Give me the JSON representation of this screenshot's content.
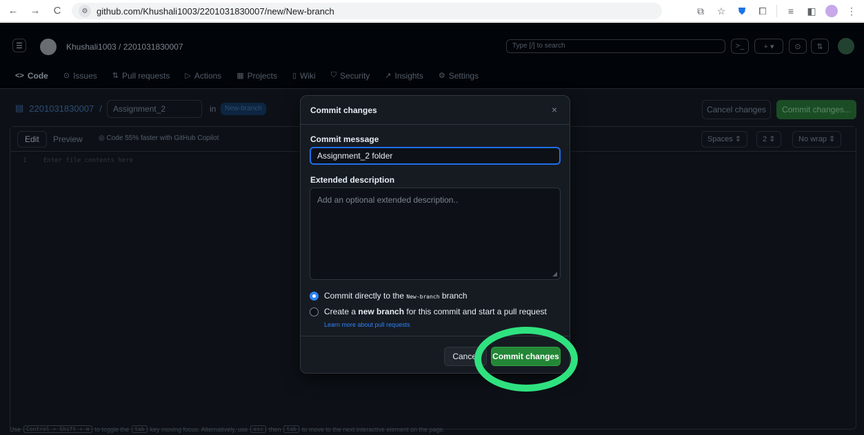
{
  "browser": {
    "url": "github.com/Khushali1003/2201031830007/new/New-branch",
    "back_glyph": "←",
    "forward_glyph": "→",
    "reload_glyph": "C",
    "site_glyph": "⚙"
  },
  "header": {
    "repo_path": "Khushali1003 / 2201031830007",
    "search_placeholder": "Type [/] to search",
    "plus_label": "+ ▾"
  },
  "repo_nav": {
    "tabs": [
      {
        "label": "Code",
        "icon": "<>"
      },
      {
        "label": "Issues",
        "icon": "⊙"
      },
      {
        "label": "Pull requests",
        "icon": "⇅"
      },
      {
        "label": "Actions",
        "icon": "▷"
      },
      {
        "label": "Projects",
        "icon": "▦"
      },
      {
        "label": "Wiki",
        "icon": "▯"
      },
      {
        "label": "Security",
        "icon": "⛉"
      },
      {
        "label": "Insights",
        "icon": "↗"
      },
      {
        "label": "Settings",
        "icon": "⚙"
      }
    ]
  },
  "editor_bar": {
    "repo_link": "2201031830007",
    "slash": "/",
    "filename": "Assignment_2",
    "in_label": "in",
    "branch": "New-branch",
    "cancel_label": "Cancel changes",
    "commit_label": "Commit changes..."
  },
  "editor": {
    "edit_tab": "Edit",
    "preview_tab": "Preview",
    "copilot_text": "Code 55% faster with GitHub Copilot",
    "indent_mode": "Spaces",
    "indent_size": "2",
    "wrap_mode": "No wrap",
    "line_number": "1",
    "placeholder": "Enter file contents here"
  },
  "hint": {
    "prefix": "Use",
    "keys": "Control + Shift + m",
    "middle": "to toggle the",
    "tab_key": "tab",
    "middle2": "key moving focus. Alternatively, use",
    "esc_key": "esc",
    "then": "then",
    "tab_key2": "tab",
    "suffix": "to move to the next interactive element on the page."
  },
  "modal": {
    "title": "Commit changes",
    "close_glyph": "×",
    "commit_message_label": "Commit message",
    "commit_message_value": "Assignment_2 folder",
    "extended_label": "Extended description",
    "extended_placeholder": "Add an optional extended description..",
    "option_direct_prefix": "Commit directly to the",
    "option_direct_branch": "New-branch",
    "option_direct_suffix": "branch",
    "option_new_prefix": "Create a",
    "option_new_bold": "new branch",
    "option_new_suffix": "for this commit and start a pull request",
    "learn_more": "Learn more about pull requests",
    "cancel_label": "Cancel",
    "commit_label": "Commit changes"
  },
  "colors": {
    "accent_blue": "#1f6feb",
    "commit_green": "#238636",
    "highlight_green": "#2fe27f"
  }
}
